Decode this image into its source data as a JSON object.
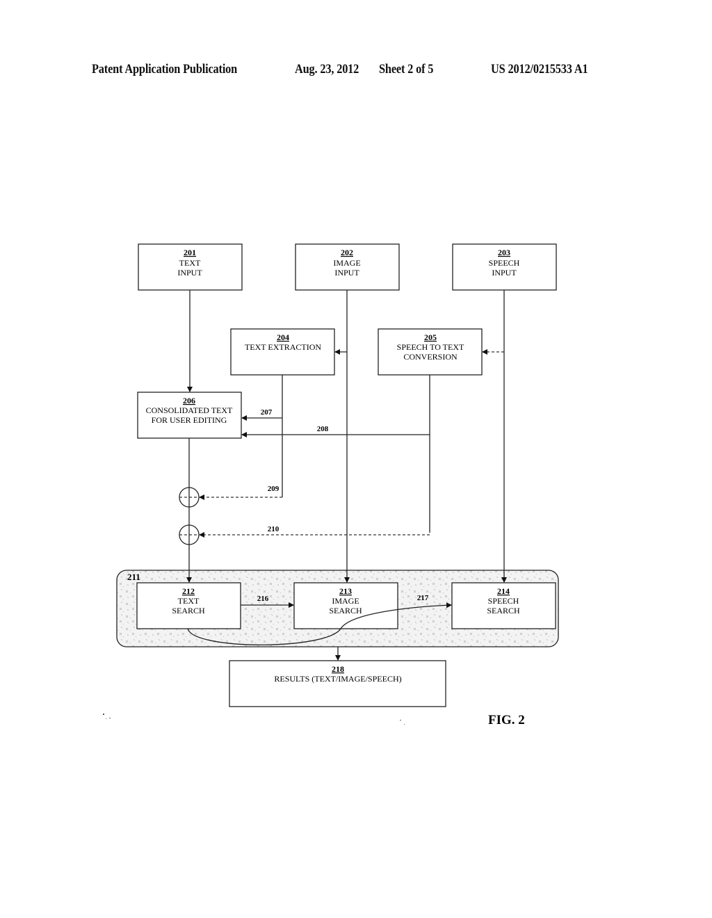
{
  "header": {
    "publication": "Patent Application Publication",
    "date": "Aug. 23, 2012",
    "sheet": "Sheet 2 of 5",
    "number": "US 2012/0215533 A1"
  },
  "figure_label": "FIG. 2",
  "nodes": {
    "n201": {
      "id": "201",
      "line1": "TEXT",
      "line2": "INPUT"
    },
    "n202": {
      "id": "202",
      "line1": "IMAGE",
      "line2": "INPUT"
    },
    "n203": {
      "id": "203",
      "line1": "SPEECH",
      "line2": "INPUT"
    },
    "n204": {
      "id": "204",
      "line1": "TEXT EXTRACTION",
      "line2": ""
    },
    "n205": {
      "id": "205",
      "line1": "SPEECH TO TEXT",
      "line2": "CONVERSION"
    },
    "n206": {
      "id": "206",
      "line1": "CONSOLIDATED TEXT",
      "line2": "FOR USER EDITING"
    },
    "n211": {
      "id": "211"
    },
    "n212": {
      "id": "212",
      "line1": "TEXT",
      "line2": "SEARCH"
    },
    "n213": {
      "id": "213",
      "line1": "IMAGE",
      "line2": "SEARCH"
    },
    "n214": {
      "id": "214",
      "line1": "SPEECH",
      "line2": "SEARCH"
    },
    "n218": {
      "id": "218",
      "line1": "RESULTS (TEXT/IMAGE/SPEECH)"
    }
  },
  "edges": {
    "e207": "207",
    "e208": "208",
    "e209": "209",
    "e210": "210",
    "e216": "216",
    "e217": "217"
  }
}
